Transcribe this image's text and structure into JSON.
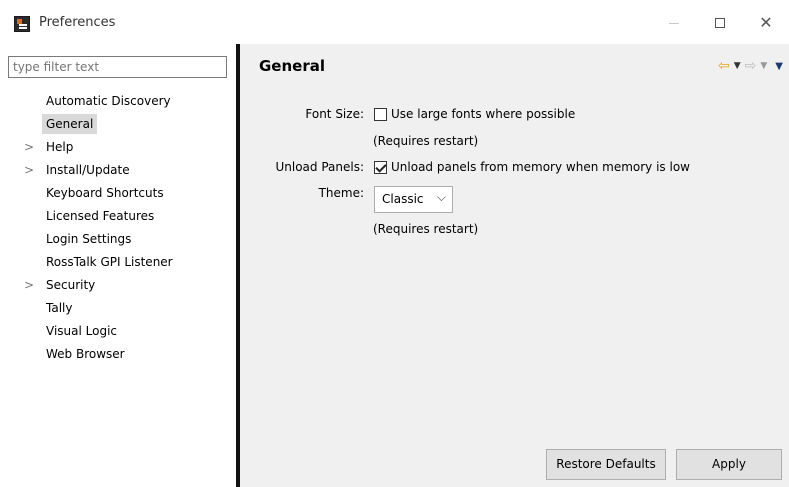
{
  "window": {
    "title": "Preferences"
  },
  "filter": {
    "placeholder": "type filter text"
  },
  "tree": [
    {
      "label": "Automatic Discovery",
      "expandable": false,
      "selected": false
    },
    {
      "label": "General",
      "expandable": false,
      "selected": true
    },
    {
      "label": "Help",
      "expandable": true,
      "selected": false
    },
    {
      "label": "Install/Update",
      "expandable": true,
      "selected": false
    },
    {
      "label": "Keyboard Shortcuts",
      "expandable": false,
      "selected": false
    },
    {
      "label": "Licensed Features",
      "expandable": false,
      "selected": false
    },
    {
      "label": "Login Settings",
      "expandable": false,
      "selected": false
    },
    {
      "label": "RossTalk GPI Listener",
      "expandable": false,
      "selected": false
    },
    {
      "label": "Security",
      "expandable": true,
      "selected": false
    },
    {
      "label": "Tally",
      "expandable": false,
      "selected": false
    },
    {
      "label": "Visual Logic",
      "expandable": false,
      "selected": false
    },
    {
      "label": "Web Browser",
      "expandable": false,
      "selected": false
    }
  ],
  "page": {
    "title": "General",
    "font_size": {
      "label": "Font Size:",
      "checkbox_label": "Use large fonts where possible",
      "checked": false,
      "note": "(Requires restart)"
    },
    "unload_panels": {
      "label": "Unload Panels:",
      "checkbox_label": "Unload panels from memory when memory is low",
      "checked": true
    },
    "theme": {
      "label": "Theme:",
      "value": "Classic",
      "note": "(Requires restart)"
    }
  },
  "buttons": {
    "restore_defaults": "Restore Defaults",
    "apply": "Apply"
  },
  "colors": {
    "nav_back": "#e8a317",
    "selection": "#d9d9d9",
    "panel_bg": "#f0f0f0"
  },
  "icons": {
    "back": "arrow-left-icon",
    "forward": "arrow-right-icon",
    "view_menu": "view-menu-icon"
  }
}
